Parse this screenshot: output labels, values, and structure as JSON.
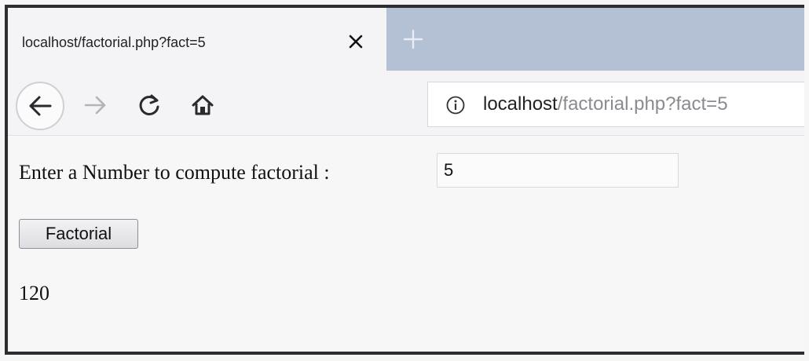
{
  "browser": {
    "tab": {
      "title": "localhost/factorial.php?fact=5"
    },
    "urlbar": {
      "host": "localhost",
      "path": "/factorial.php?fact=5"
    },
    "icons": {
      "close": "close-icon",
      "new_tab": "plus-icon",
      "back": "arrow-left-icon",
      "forward": "arrow-right-icon",
      "reload": "reload-icon",
      "home": "home-icon",
      "info": "info-icon"
    },
    "colors": {
      "tabstrip": "#b4c0d3",
      "url_path": "#8a8a90"
    }
  },
  "page": {
    "prompt": "Enter a Number to compute factorial :",
    "input_value": "5",
    "button_label": "Factorial",
    "result": "120"
  }
}
